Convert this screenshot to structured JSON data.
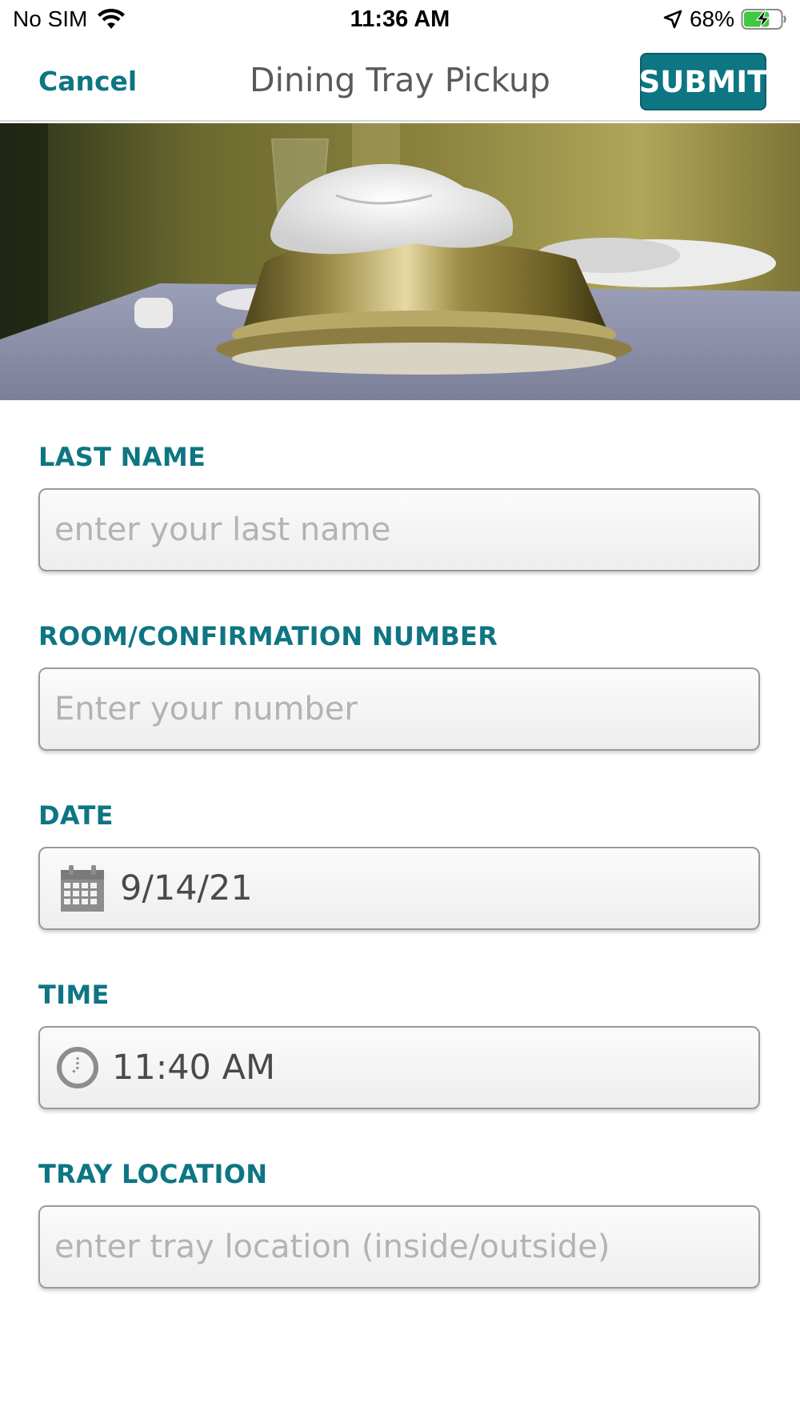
{
  "status_bar": {
    "carrier": "No SIM",
    "time": "11:36 AM",
    "battery": "68%",
    "wifi_icon": "wifi-icon",
    "location_icon": "location-arrow-icon",
    "battery_icon": "battery-charging-icon",
    "battery_level": 0.68
  },
  "nav": {
    "cancel_label": "Cancel",
    "title": "Dining Tray Pickup",
    "submit_label": "SUBMIT"
  },
  "hero": {
    "image": "covered dining tray on table"
  },
  "form": {
    "last_name": {
      "label": "LAST NAME",
      "placeholder": "enter your last name"
    },
    "room_number": {
      "label": "ROOM/CONFIRMATION NUMBER",
      "placeholder": "Enter your number"
    },
    "date": {
      "label": "DATE",
      "value": "9/14/21",
      "icon": "calendar-icon"
    },
    "time": {
      "label": "TIME",
      "value": "11:40 AM",
      "icon": "clock-icon"
    },
    "tray_location": {
      "label": "TRAY LOCATION",
      "placeholder": "enter tray location (inside/outside)"
    }
  },
  "colors": {
    "accent": "#0e7583",
    "title_gray": "#5a5a5a",
    "placeholder_gray": "#b3b3b3",
    "battery_green": "#3fc93f"
  }
}
